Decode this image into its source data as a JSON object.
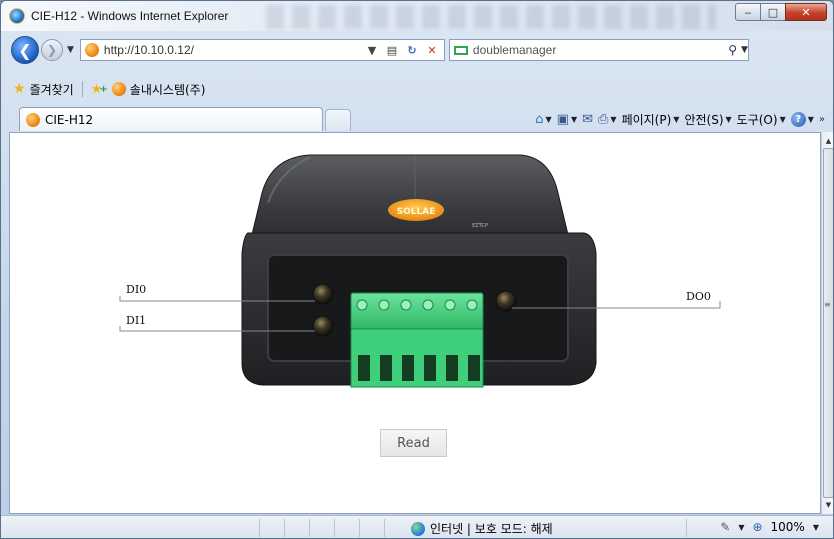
{
  "window": {
    "title": "CIE-H12 - Windows Internet Explorer",
    "min_label": "‒",
    "max_label": "□",
    "close_label": "✕"
  },
  "navigation": {
    "back_glyph": "❮",
    "forward_glyph": "❯",
    "address": "http://10.10.0.12/",
    "search_provider": "doublemanager"
  },
  "favorites": {
    "label": "즐겨찾기",
    "site": "솔내시스템(주)"
  },
  "tabs": [
    {
      "label": "CIE-H12"
    }
  ],
  "commands": {
    "page": "페이지(P)",
    "safety": "안전(S)",
    "tools": "도구(O)"
  },
  "device": {
    "brand": "SOLLAE",
    "model_tag": "EZTCP",
    "labels": {
      "di0": "DI0",
      "di1": "DI1",
      "do0": "DO0"
    },
    "read_button": "Read"
  },
  "status": {
    "zone": "인터넷 | 보호 모드: 해제",
    "zoom": "100%"
  },
  "colors": {
    "terminal_green": "#3fcf7a",
    "brand_orange": "#f29a1a",
    "device_body": "#2c2d30"
  }
}
